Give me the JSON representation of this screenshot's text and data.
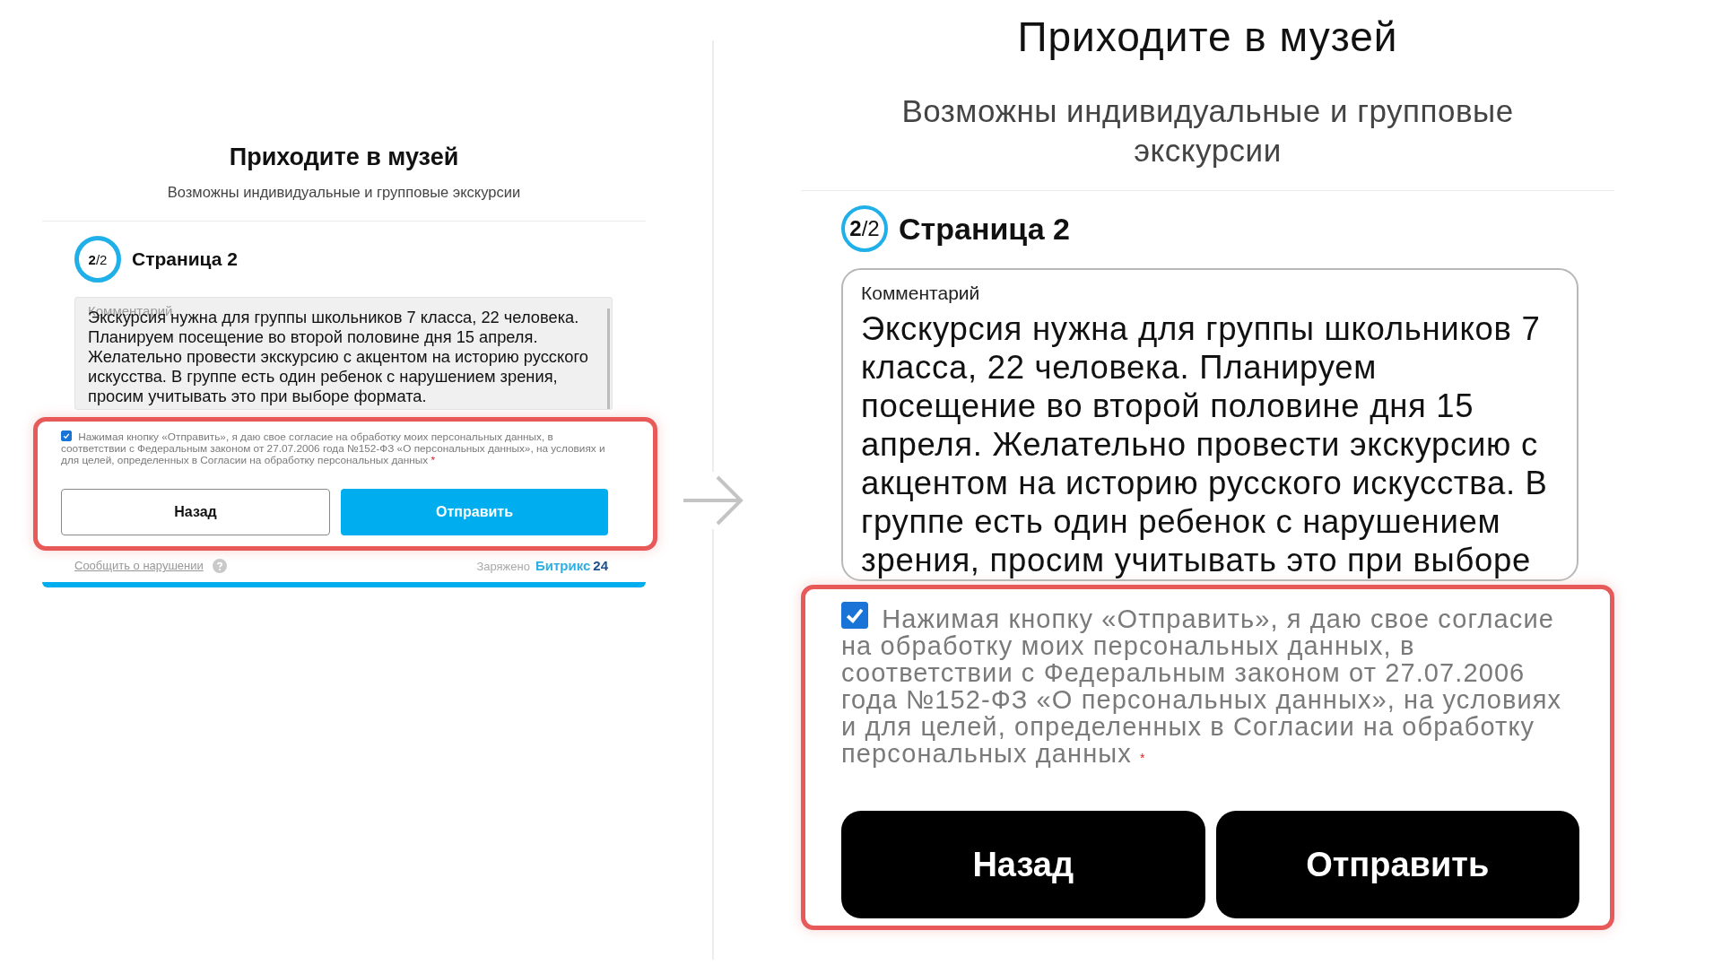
{
  "panels": [
    {
      "kind": "desktop",
      "title": "Приходите в музей",
      "subtitle": "Возможны индивидуальные и групповые экскурсии",
      "step": {
        "badge": "**2**/2",
        "title": "Страница 2"
      },
      "comment": {
        "label": "Комментарий",
        "value": "Экскурсия нужна для группы школьников 7 класса, 22 человека. Планируем посещение во второй половине дня 15 апреля. Желательно провести экскурсию с акцентом на историю русского искусства. В группе есть один ребенок с нарушением зрения, просим учитывать это при выборе формата."
      },
      "consent": {
        "checked": true,
        "text": "Нажимая кнопку «Отправить», я даю свое согласие на обработку моих персональных данных, в соответствии с Федеральным законом от 27.07.2006 года №152-ФЗ «О персональных данных», на условиях и для целей, определенных в Согласии на обработку персональных данных",
        "required_mark": "*"
      },
      "highlighted": true,
      "buttons": [
        {
          "label": "Назад",
          "kind": "secondary"
        },
        {
          "label": "Отправить",
          "kind": "primary"
        }
      ],
      "footer": {
        "report_link": "Сообщить о нарушении",
        "powered_prefix": "Заряжено",
        "brand": "Битрикс",
        "brand_number": "24"
      }
    },
    {
      "kind": "mobile",
      "title": "Приходите в музей",
      "subtitle": "Возможны индивидуальные и групповые экскурсии",
      "step": {
        "badge": "**2**/2",
        "title": "Страница 2"
      },
      "comment": {
        "label": "Комментарий",
        "value": "Экскурсия нужна для группы школьников 7 класса, 22 человека. Планируем посещение во второй половине дня 15 апреля. Желательно провести экскурсию с акцентом на историю русского искусства. В группе есть один ребенок с нарушением зрения, просим учитывать это при выборе"
      },
      "consent": {
        "checked": true,
        "text": "Нажимая кнопку «Отправить», я даю свое согласие на обработку моих персональных данных, в соответствии с Федеральным законом от 27.07.2006 года №152-ФЗ «О персональных данных», на условиях и для целей, определенных в Согласии на обработку персональных данных",
        "required_mark": "*"
      },
      "highlighted": true,
      "buttons": [
        {
          "label": "Назад",
          "kind": "secondary"
        },
        {
          "label": "Отправить",
          "kind": "primary"
        }
      ]
    }
  ]
}
